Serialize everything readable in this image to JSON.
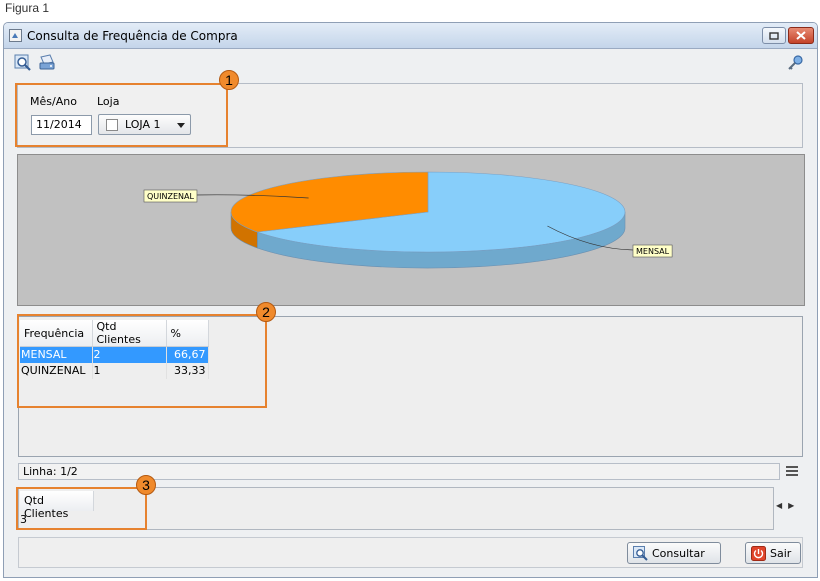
{
  "caption": "Figura 1",
  "window": {
    "title": "Consulta de Frequência de Compra"
  },
  "toolbar": {
    "icons": [
      "search-icon",
      "print-icon",
      "key-icon"
    ]
  },
  "filters": {
    "mes_ano_label": "Mês/Ano",
    "mes_ano_value": "11/2014",
    "loja_label": "Loja",
    "loja_value": "LOJA 1"
  },
  "chart_data": {
    "type": "pie",
    "categories": [
      "MENSAL",
      "QUINZENAL"
    ],
    "values": [
      66.67,
      33.33
    ],
    "colors": [
      "#87cefa",
      "#ff8c00"
    ],
    "labels": [
      "MENSAL",
      "QUINZENAL"
    ]
  },
  "grid": {
    "columns": [
      "Frequência",
      "Qtd Clientes",
      "%"
    ],
    "rows": [
      {
        "frequencia": "MENSAL",
        "qtd": "2",
        "pct": "66,67"
      },
      {
        "frequencia": "QUINZENAL",
        "qtd": "1",
        "pct": "33,33"
      }
    ]
  },
  "status": {
    "linha": "Linha: 1/2"
  },
  "totals": {
    "header": "Qtd Clientes",
    "value": "3"
  },
  "buttons": {
    "consultar": "Consultar",
    "sair": "Sair"
  },
  "callouts": [
    "1",
    "2",
    "3"
  ],
  "colors": {
    "accent_orange": "#e6822f",
    "selection_blue": "#3399ff",
    "chart_bg": "#c1c1c1"
  }
}
